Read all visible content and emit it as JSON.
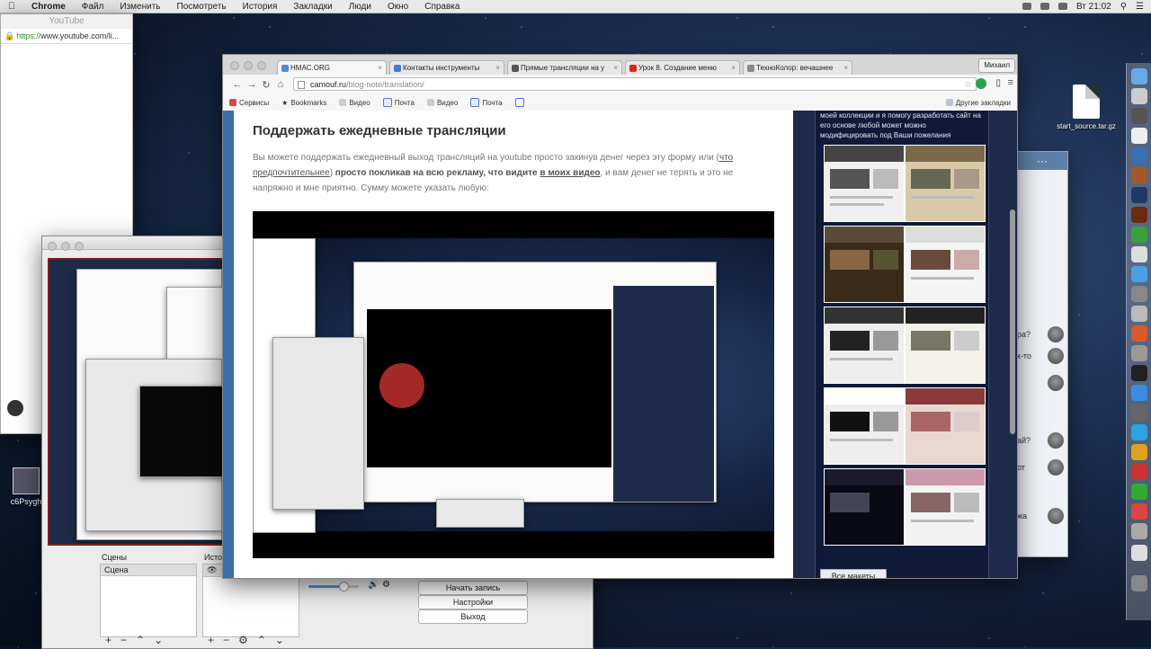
{
  "menubar": {
    "apple": "",
    "items": [
      "Chrome",
      "Файл",
      "Изменить",
      "Посмотреть",
      "История",
      "Закладки",
      "Люди",
      "Окно",
      "Справка"
    ],
    "clock": "Вт 21:02"
  },
  "youtube_window": {
    "title": "YouTube",
    "url_scheme": "https://",
    "url_rest": "www.youtube.com/li..."
  },
  "obs": {
    "scenes_label": "Сцены",
    "scene_item": "Сцена",
    "sources_label": "Источники",
    "buttons": [
      "Начать запись",
      "Настройки",
      "Выход"
    ],
    "volume_level": 0.7
  },
  "desktop": {
    "left_icon_label": "c6Psygh",
    "file_label": "start_source.tar.gz"
  },
  "chrome": {
    "profile": "Михаил",
    "tabs": [
      {
        "title": "HMAC.ORG",
        "color": "#4a8fd8"
      },
      {
        "title": "Контакты инструменты",
        "color": "#3b7ed6"
      },
      {
        "title": "Прямые трансляции на y",
        "color": "#555555"
      },
      {
        "title": "Урок 8. Создание меню",
        "color": "#e62117"
      },
      {
        "title": "ТехноКолор: вечашнее",
        "color": "#888888"
      }
    ],
    "url_host": "camouf.ru",
    "url_path": "/blog-note/translation/",
    "bookmarks": [
      "Сервисы",
      "Bookmarks",
      "Видео",
      "Почта",
      "Видео",
      "Почта"
    ],
    "other_bookmarks": "Другие закладки",
    "page": {
      "heading": "Поддержать ежедневные трансляции",
      "p1": "Вы можете поддержать ежедневный выход трансляций на youtube просто закинув денег через эту форму или (",
      "p_link": "что предпочтительнее",
      "p2": ") ",
      "p_bold1": "просто покликав на всю рекламу, что видите ",
      "p_bold_link": "в моих видео",
      "p3": ", и вам денег не терять и это не напряжно и мне приятно. Сумму можете указать любую:"
    },
    "sidebar": {
      "text": "моей коллекции и я помогу разработать сайт на его основе любой может можно модифицировать под Ваши пожелания",
      "all_button": "Все макеты"
    }
  },
  "chat": {
    "rows": [
      "ра?",
      "к-то",
      "ай?",
      "от",
      "жа"
    ]
  }
}
